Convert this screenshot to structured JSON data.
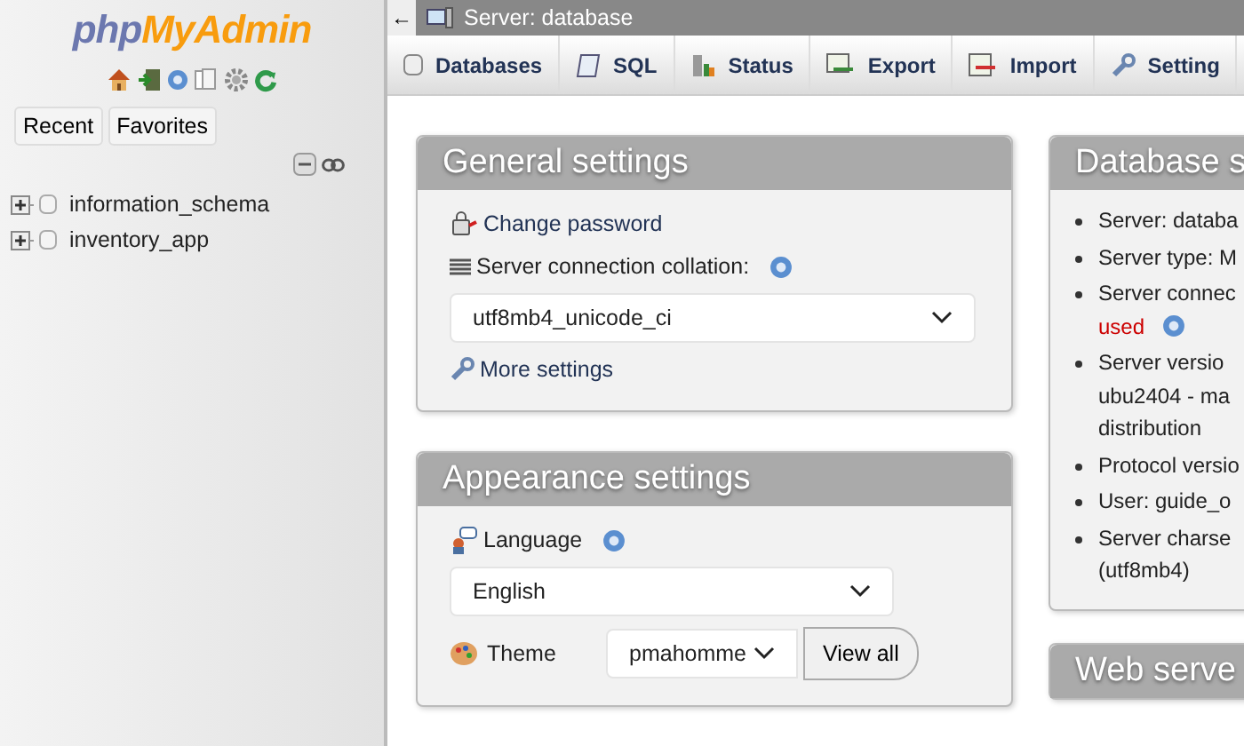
{
  "sidebar": {
    "logo": {
      "first": "php",
      "second": "MyAdmin"
    },
    "buttons": [
      "Recent",
      "Favorites"
    ],
    "databases": [
      {
        "name": "information_schema",
        "expanded": false
      },
      {
        "name": "inventory_app",
        "expanded": false
      }
    ]
  },
  "topbar": {
    "back": "←",
    "title": "Server: database"
  },
  "tabs": [
    {
      "label": "Databases",
      "kind": "databases",
      "selected": false
    },
    {
      "label": "SQL",
      "kind": "sql",
      "selected": false
    },
    {
      "label": "Status",
      "kind": "status",
      "selected": false
    },
    {
      "label": "Export",
      "kind": "export",
      "selected": false
    },
    {
      "label": "Import",
      "kind": "import",
      "selected": false
    },
    {
      "label": "Setting",
      "kind": "settings",
      "selected": false
    }
  ],
  "general": {
    "title": "General settings",
    "change_password": "Change password",
    "collation_label": "Server connection collation:",
    "collation_value": "utf8mb4_unicode_ci",
    "more_settings": "More settings"
  },
  "appearance": {
    "title": "Appearance settings",
    "language_label": "Language",
    "language_value": "English",
    "theme_label": "Theme",
    "theme_value": "pmahomme",
    "view_all": "View all"
  },
  "database_server": {
    "title": "Database s",
    "items": [
      {
        "lines": [
          "Server: databa"
        ]
      },
      {
        "lines": [
          "Server type: M"
        ]
      },
      {
        "lines": [
          "Server connec"
        ],
        "warning": "used"
      },
      {
        "lines": [
          "Server versio",
          "ubu2404 - ma",
          "distribution"
        ]
      },
      {
        "lines": [
          "Protocol versio"
        ]
      },
      {
        "lines": [
          "User: guide_o"
        ]
      },
      {
        "lines": [
          "Server charse",
          "(utf8mb4)"
        ]
      }
    ]
  },
  "web_server": {
    "title": "Web serve"
  }
}
